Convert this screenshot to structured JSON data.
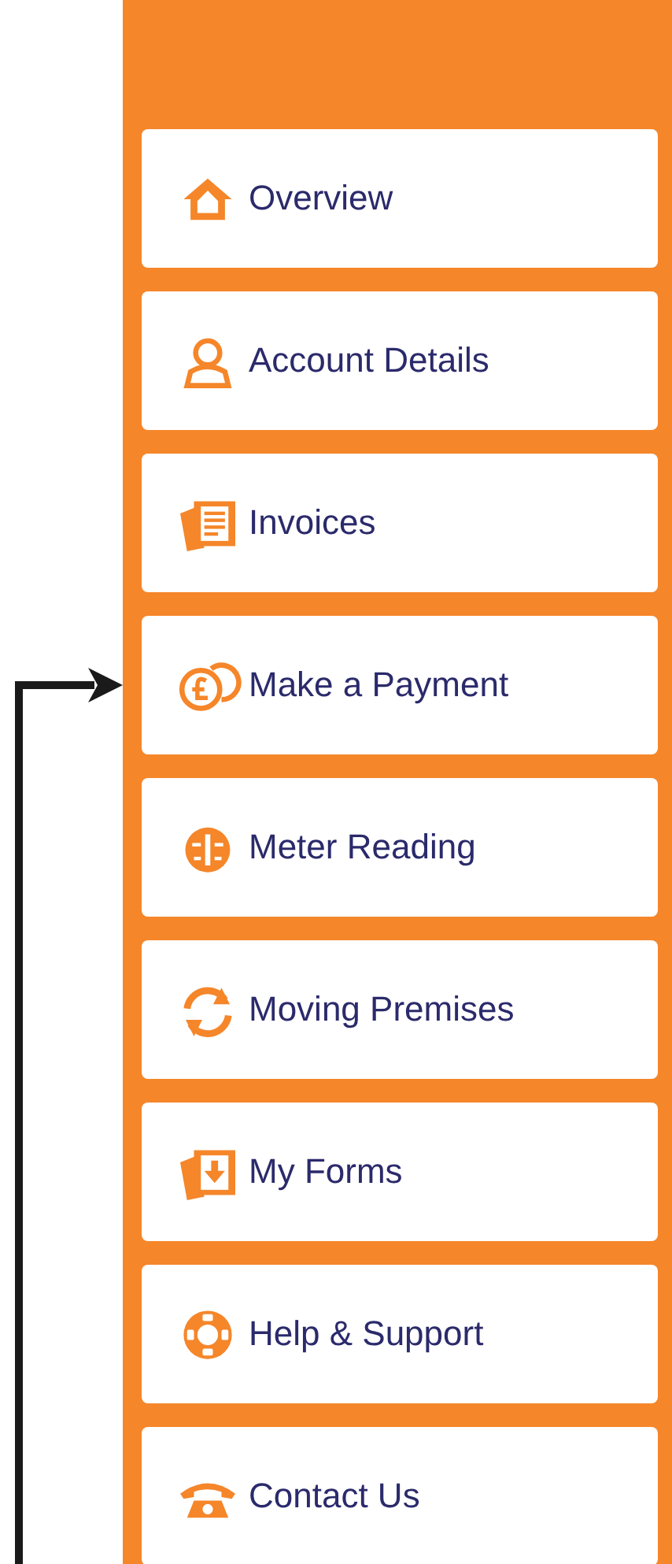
{
  "menu": [
    {
      "label": "Overview",
      "kind": "home",
      "pointed": false
    },
    {
      "label": "Account Details",
      "kind": "person",
      "pointed": false
    },
    {
      "label": "Invoices",
      "kind": "documents",
      "pointed": false
    },
    {
      "label": "Make a Payment",
      "kind": "coins",
      "pointed": true
    },
    {
      "label": "Meter Reading",
      "kind": "gauge",
      "pointed": false
    },
    {
      "label": "Moving Premises",
      "kind": "refresh",
      "pointed": false
    },
    {
      "label": "My Forms",
      "kind": "forms",
      "pointed": false
    },
    {
      "label": "Help & Support",
      "kind": "lifebuoy",
      "pointed": false
    },
    {
      "label": "Contact Us",
      "kind": "phone",
      "pointed": false
    }
  ]
}
